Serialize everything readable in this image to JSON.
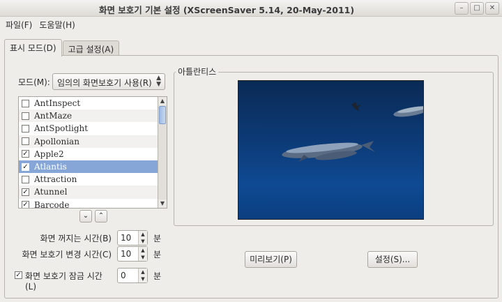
{
  "window": {
    "title": "화면 보호기 기본 설정  (XScreenSaver 5.14, 20-May-2011)",
    "controls": [
      "–",
      "□",
      "✕"
    ]
  },
  "menubar": {
    "items": [
      "파일(F)",
      "도움말(H)"
    ]
  },
  "tabs": [
    {
      "label": "표시 모드(D)",
      "active": true
    },
    {
      "label": "고급 설정(A)",
      "active": false
    }
  ],
  "mode": {
    "label": "모드(M):",
    "selected": "임의의 화면보호기 사용(R)"
  },
  "screensaver_list": [
    {
      "name": "AntInspect",
      "checked": false
    },
    {
      "name": "AntMaze",
      "checked": false
    },
    {
      "name": "AntSpotlight",
      "checked": false
    },
    {
      "name": "Apollonian",
      "checked": false
    },
    {
      "name": "Apple2",
      "checked": true
    },
    {
      "name": "Atlantis",
      "checked": true,
      "selected": true
    },
    {
      "name": "Attraction",
      "checked": false
    },
    {
      "name": "Atunnel",
      "checked": true
    },
    {
      "name": "Barcode",
      "checked": true
    }
  ],
  "list_nav": {
    "down": "⌄",
    "up": "⌃"
  },
  "timers": {
    "blank_after": {
      "label": "화면 꺼지는 시간(B)",
      "value": "10",
      "unit": "분"
    },
    "cycle_after": {
      "label": "화면 보호기 변경 시간(C)",
      "value": "10",
      "unit": "분"
    },
    "lock_after": {
      "label": "화면 보호기 잠금 시간(L)",
      "value": "0",
      "unit": "분",
      "checked": true
    }
  },
  "preview": {
    "title": "아틀란티스"
  },
  "buttons": {
    "preview": "미리보기(P)",
    "settings": "설정(S)..."
  },
  "colors": {
    "selection": "#86a6d8",
    "preview_bg": "#0d3b78"
  }
}
